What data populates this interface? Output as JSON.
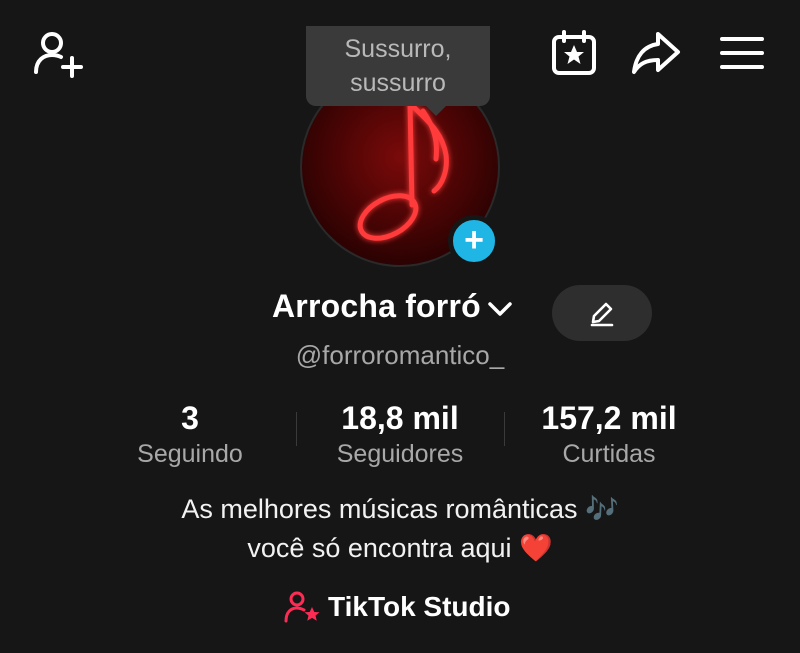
{
  "header": {
    "add_friend_icon": "person-plus-icon",
    "calendar_icon": "calendar-star-icon",
    "share_icon": "share-arrow-icon",
    "menu_icon": "hamburger-menu-icon"
  },
  "tooltip": {
    "line1": "Sussurro,",
    "line2": "sussurro"
  },
  "profile": {
    "name": "Arrocha forró",
    "username": "@forroromantico_",
    "badge_color": "#1fb6e6"
  },
  "stats": [
    {
      "value": "3",
      "label": "Seguindo"
    },
    {
      "value": "18,8 mil",
      "label": "Seguidores"
    },
    {
      "value": "157,2 mil",
      "label": "Curtidas"
    }
  ],
  "bio": {
    "line1": "As melhores músicas românticas 🎶",
    "line2": "você só encontra aqui ❤️"
  },
  "studio": {
    "label": "TikTok Studio",
    "icon_color": "#fe2c55"
  }
}
